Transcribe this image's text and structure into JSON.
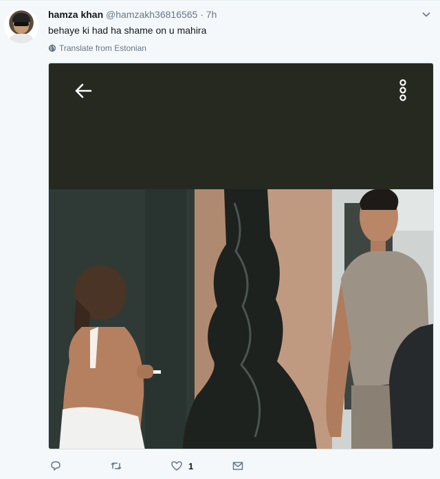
{
  "tweet": {
    "author_name": "hamza khan",
    "handle": "@hamzakh36816565",
    "separator": "·",
    "time": "7h",
    "text": "behaye ki had ha shame on u mahira",
    "translate_label": "Translate from Estonian"
  },
  "actions": {
    "like_count": "1"
  },
  "icons": [
    "chevron-down-icon",
    "globe-icon",
    "back-arrow-icon",
    "more-vertical-icon",
    "reply-icon",
    "retweet-icon",
    "heart-icon",
    "message-icon"
  ],
  "colors": {
    "background": "#f5f8fa",
    "secondary_text": "#657786",
    "media_dark": "#252920"
  }
}
